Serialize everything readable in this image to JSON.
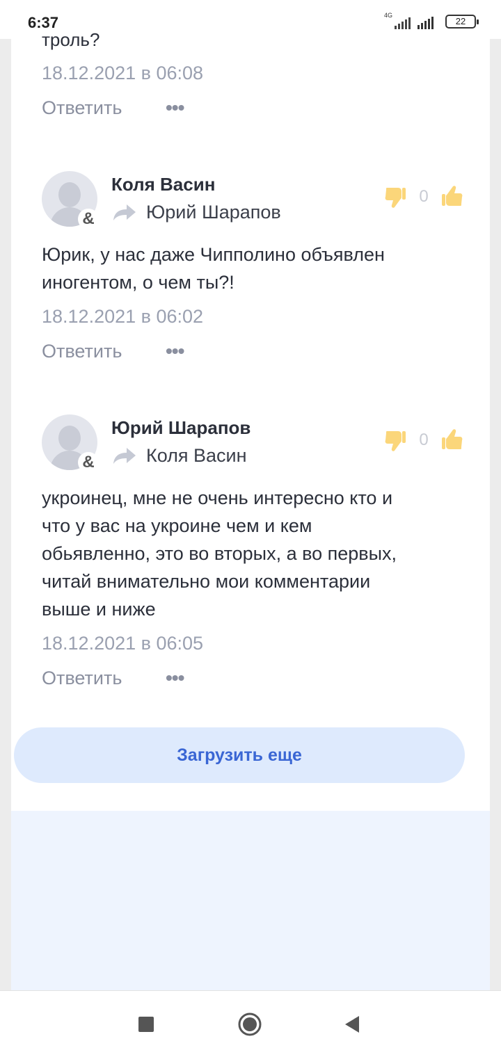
{
  "status_bar": {
    "time": "6:37",
    "network": "4G",
    "battery": "22"
  },
  "comments": [
    {
      "text_truncated": "троль?",
      "date": "18.12.2021 в 06:08",
      "reply_label": "Ответить",
      "more_label": "•••"
    },
    {
      "author": "Коля Васин",
      "reply_to": "Юрий Шарапов",
      "vote_count": "0",
      "text": "Юрик, у нас даже Чипполино объявлен иногентом, о чем ты?!",
      "text_lines": [
        "Юрик, у нас даже Чипполино объявлен",
        "иногентом, о чем ты?!"
      ],
      "date": "18.12.2021 в 06:02",
      "reply_label": "Ответить",
      "more_label": "•••"
    },
    {
      "author": "Юрий Шарапов",
      "reply_to": "Коля Васин",
      "vote_count": "0",
      "text": "укроинец, мне не очень интересно кто и что у вас на укроине чем и кем обьявленно, это во вторых, а во первых, читай внимательно мои комментарии выше и ниже",
      "text_lines": [
        "укроинец, мне не очень интересно кто и",
        "что у вас на укроине чем и кем",
        "обьявленно, это во вторых, а во первых,",
        "читай внимательно мои комментарии",
        "выше и ниже"
      ],
      "date": "18.12.2021 в 06:05",
      "reply_label": "Ответить",
      "more_label": "•••"
    }
  ],
  "load_more_label": "Загрузить еще",
  "colors": {
    "accent": "#3a66d4",
    "load_more_bg": "#deeafd",
    "thumb": "#fbd67a",
    "muted": "#8a8f9f"
  },
  "icons": {
    "thumb_down": "thumb-down-icon",
    "thumb_up": "thumb-up-icon",
    "reply_arrow": "reply-arrow-icon",
    "nav_recents": "square-icon",
    "nav_home": "circle-icon",
    "nav_back": "triangle-back-icon"
  }
}
